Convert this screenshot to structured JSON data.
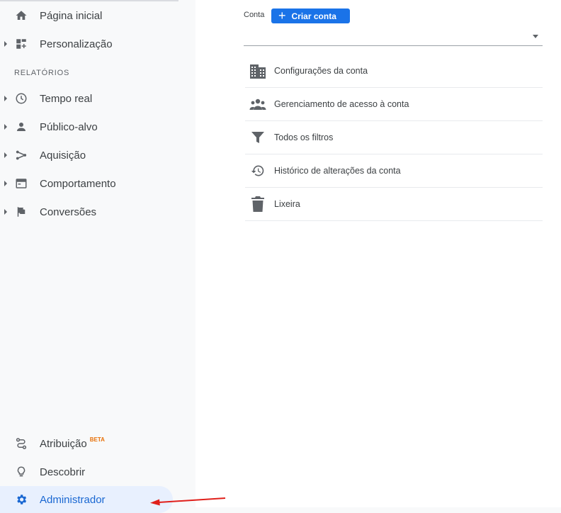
{
  "sidebar": {
    "items": [
      {
        "label": "Página inicial",
        "icon": "home-icon"
      },
      {
        "label": "Personalização",
        "icon": "dashboard-icon"
      }
    ],
    "section_title": "RELATÓRIOS",
    "reports": [
      {
        "label": "Tempo real",
        "icon": "clock-icon"
      },
      {
        "label": "Público-alvo",
        "icon": "person-icon"
      },
      {
        "label": "Aquisição",
        "icon": "acquisition-icon"
      },
      {
        "label": "Comportamento",
        "icon": "behavior-icon"
      },
      {
        "label": "Conversões",
        "icon": "flag-icon"
      }
    ],
    "bottom": [
      {
        "label": "Atribuição",
        "badge": "BETA",
        "icon": "attribution-icon"
      },
      {
        "label": "Descobrir",
        "icon": "lightbulb-icon"
      },
      {
        "label": "Administrador",
        "icon": "gear-icon"
      }
    ]
  },
  "account": {
    "label": "Conta",
    "create_button": "Criar conta",
    "create_icon": "plus-icon",
    "selected_value": ""
  },
  "menu": [
    {
      "label": "Configurações da conta",
      "icon": "building-icon"
    },
    {
      "label": "Gerenciamento de acesso à conta",
      "icon": "people-icon"
    },
    {
      "label": "Todos os filtros",
      "icon": "filter-icon"
    },
    {
      "label": "Histórico de alterações da conta",
      "icon": "history-icon"
    },
    {
      "label": "Lixeira",
      "icon": "trash-icon"
    }
  ],
  "colors": {
    "accent": "#1a73e8",
    "active_text": "#1967d2",
    "active_bg": "#e8f0fe",
    "beta": "#e8710a",
    "annotation_arrow": "#e0201b"
  }
}
